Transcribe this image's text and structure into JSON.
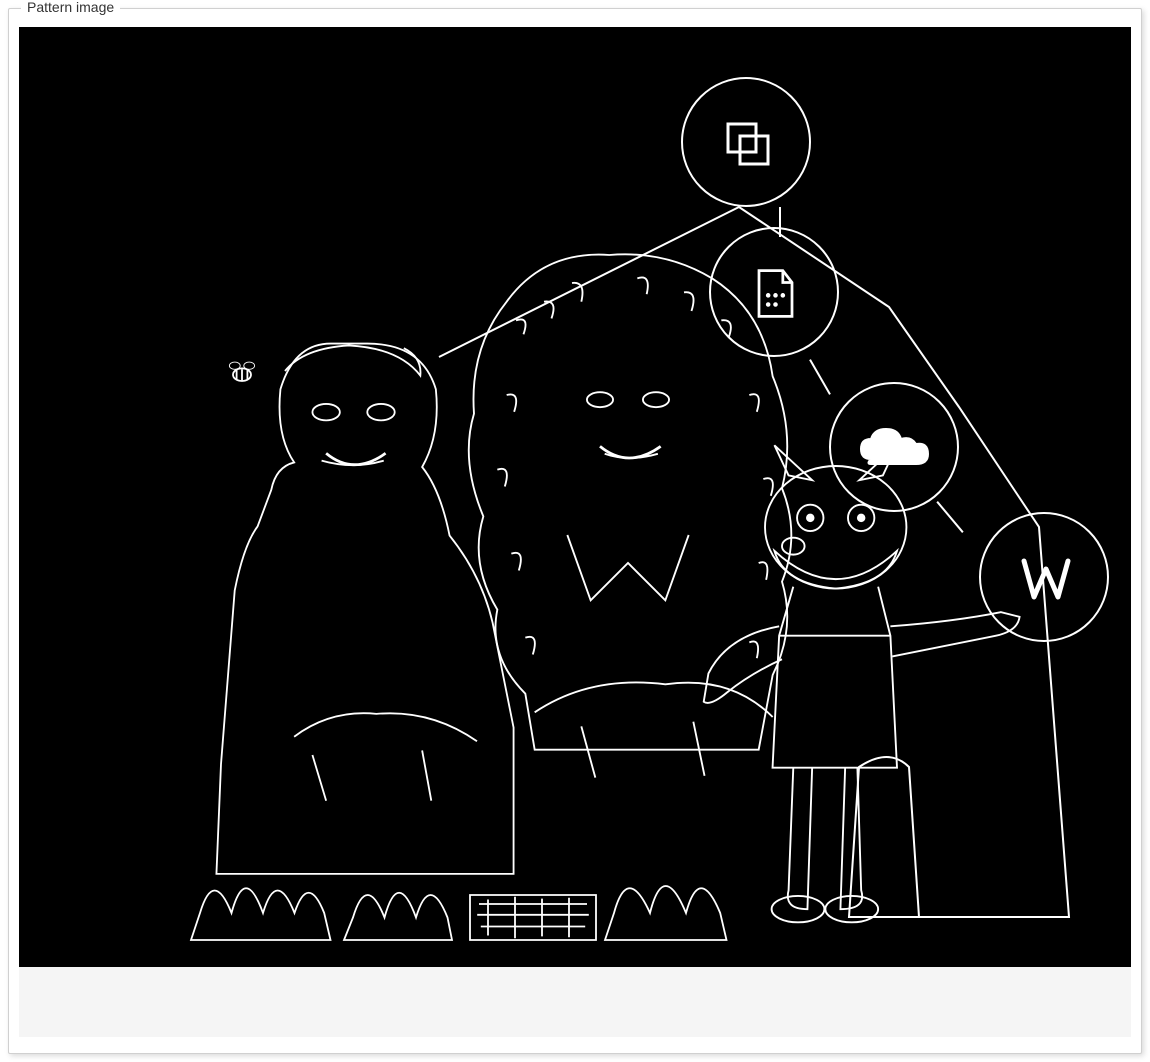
{
  "fieldset": {
    "legend": "Pattern image"
  },
  "image": {
    "description": "edge-detected-pattern",
    "icons": {
      "a": "logo-icon",
      "b": "document-icon",
      "c": "cloud-icon",
      "d": "w-icon"
    }
  }
}
